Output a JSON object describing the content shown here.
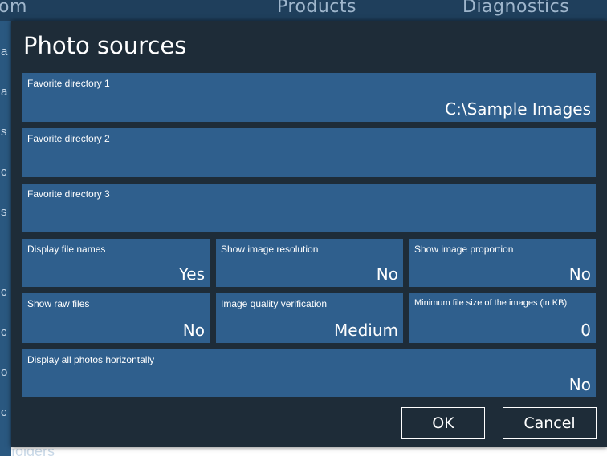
{
  "background": {
    "nav_items": [
      "om",
      "Products",
      "Diagnostics"
    ],
    "side_letters": [
      "a",
      "a",
      "s",
      "c",
      "s",
      "c",
      "c",
      "o",
      "c"
    ],
    "bottom_text": "folders"
  },
  "dialog": {
    "title": "Photo sources",
    "directories": [
      {
        "label": "Favorite directory 1",
        "value": "C:\\Sample Images"
      },
      {
        "label": "Favorite directory 2",
        "value": ""
      },
      {
        "label": "Favorite directory 3",
        "value": ""
      }
    ],
    "settings": [
      {
        "label": "Display file names",
        "value": "Yes"
      },
      {
        "label": "Show image resolution",
        "value": "No"
      },
      {
        "label": "Show image proportion",
        "value": "No"
      },
      {
        "label": "Show raw files",
        "value": "No"
      },
      {
        "label": "Image quality verification",
        "value": "Medium"
      },
      {
        "label": "Minimum file size of the images (in KB)",
        "value": "0"
      }
    ],
    "horizontal": {
      "label": "Display all photos horizontally",
      "value": "No"
    },
    "ok_label": "OK",
    "cancel_label": "Cancel"
  },
  "colors": {
    "dialog_bg": "#1e2c38",
    "tile_bg": "#2f5f8d"
  }
}
